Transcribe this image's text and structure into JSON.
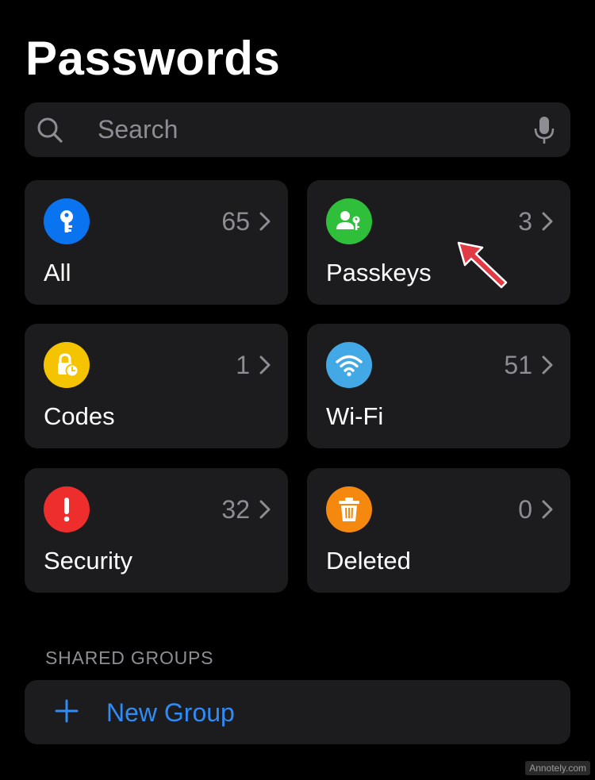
{
  "page": {
    "title": "Passwords"
  },
  "search": {
    "placeholder": "Search"
  },
  "categories": [
    {
      "label": "All",
      "count": "65",
      "icon": "key-icon",
      "color": "#0a73f0"
    },
    {
      "label": "Passkeys",
      "count": "3",
      "icon": "person-key-icon",
      "color": "#2fbf3a"
    },
    {
      "label": "Codes",
      "count": "1",
      "icon": "lock-clock-icon",
      "color": "#f5c400"
    },
    {
      "label": "Wi-Fi",
      "count": "51",
      "icon": "wifi-icon",
      "color": "#42a9e6"
    },
    {
      "label": "Security",
      "count": "32",
      "icon": "exclamation-icon",
      "color": "#ee2d2d"
    },
    {
      "label": "Deleted",
      "count": "0",
      "icon": "trash-icon",
      "color": "#f5890f"
    }
  ],
  "shared_groups": {
    "header": "SHARED GROUPS",
    "new_group_label": "New Group"
  },
  "annotation": {
    "arrow_color": "#e03a45",
    "arrow_icon": "annotation-arrow-icon"
  },
  "watermark": "Annotely.com"
}
